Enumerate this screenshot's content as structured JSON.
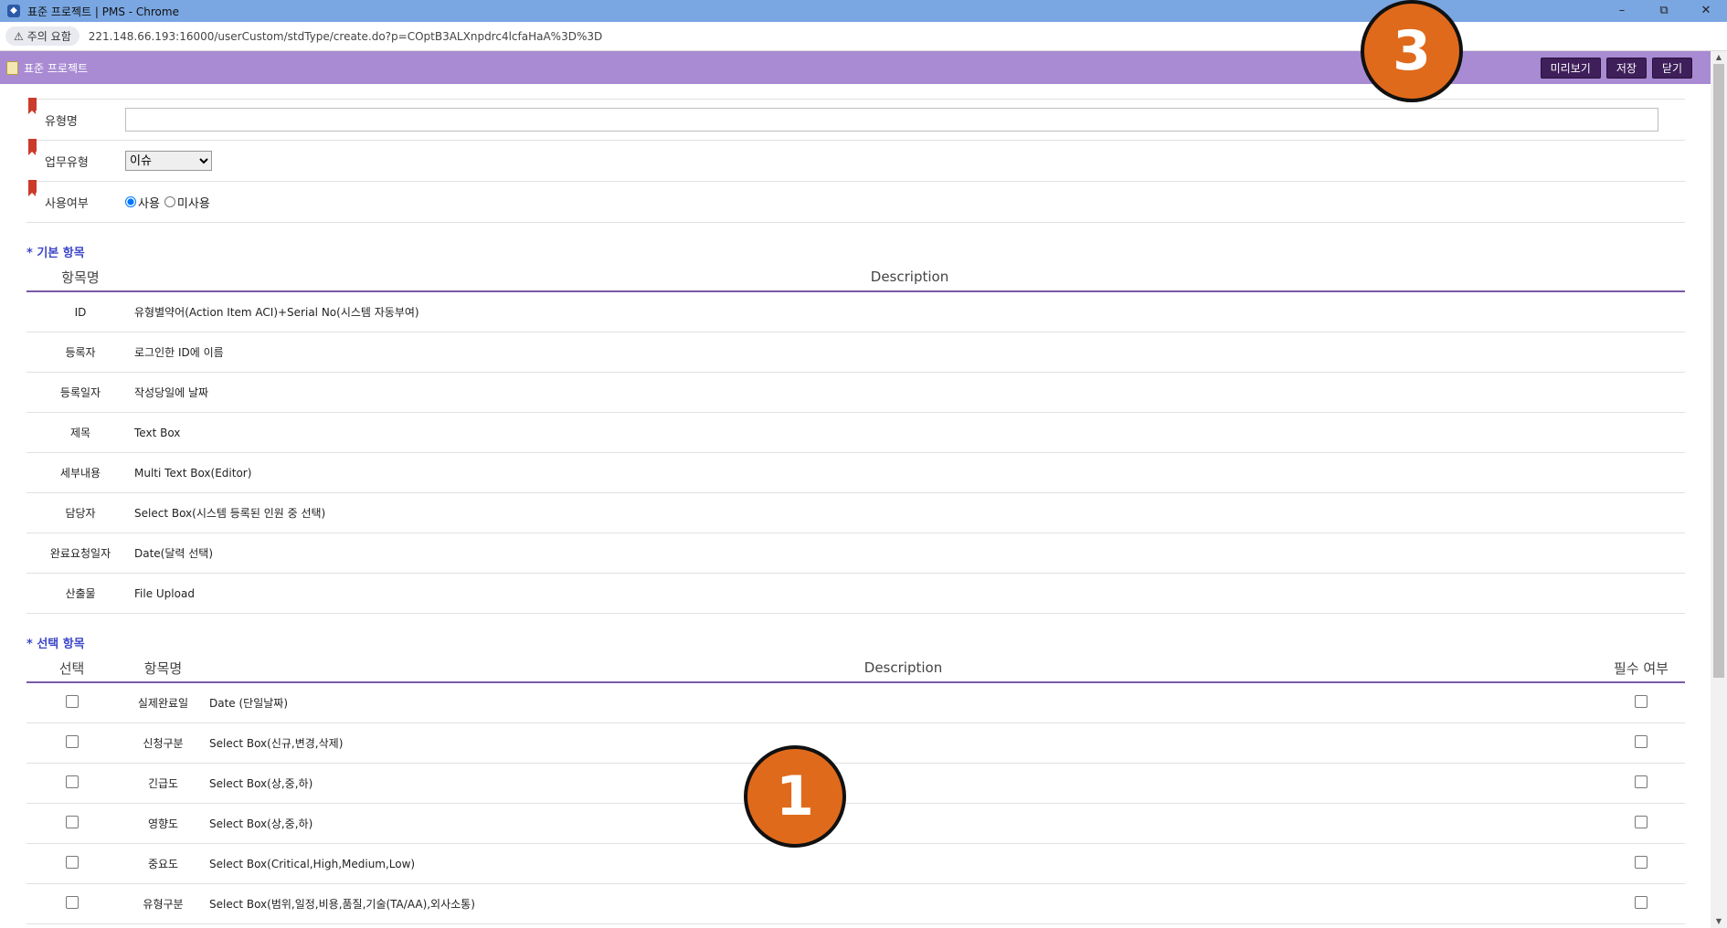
{
  "window": {
    "title": "표준 프로젝트 | PMS - Chrome",
    "minimize": "–",
    "restore": "⧉",
    "close": "✕"
  },
  "address": {
    "security_label": "주의 요함",
    "url": "221.148.66.193:16000/userCustom/stdType/create.do?p=COptB3ALXnpdrc4lcfaHaA%3D%3D"
  },
  "header": {
    "title": "표준 프로젝트",
    "buttons": {
      "preview": "미리보기",
      "save": "저장",
      "close": "닫기"
    }
  },
  "form": {
    "type_name_label": "유형명",
    "type_name_value": "",
    "work_type_label": "업무유형",
    "work_type_value": "이슈",
    "use_label": "사용여부",
    "use_option": "사용",
    "unuse_option": "미사용"
  },
  "basic": {
    "title": "* 기본 항목",
    "col_name": "항목명",
    "col_desc": "Description",
    "rows": [
      {
        "name": "ID",
        "desc": "유형별약어(Action Item ACI)+Serial No(시스템 자동부여)"
      },
      {
        "name": "등록자",
        "desc": "로그인한 ID에 이름"
      },
      {
        "name": "등록일자",
        "desc": "작성당일에 날짜"
      },
      {
        "name": "제목",
        "desc": "Text Box"
      },
      {
        "name": "세부내용",
        "desc": "Multi Text Box(Editor)"
      },
      {
        "name": "담당자",
        "desc": "Select Box(시스템 등록된 인원 중 선택)"
      },
      {
        "name": "완료요청일자",
        "desc": "Date(달력 선택)"
      },
      {
        "name": "산출물",
        "desc": "File Upload"
      }
    ]
  },
  "optional": {
    "title": "* 선택 항목",
    "col_select": "선택",
    "col_name": "항목명",
    "col_desc": "Description",
    "col_required": "필수 여부",
    "rows": [
      {
        "name": "실제완료일",
        "desc": "Date (단일날짜)"
      },
      {
        "name": "신청구분",
        "desc": "Select Box(신규,변경,삭제)"
      },
      {
        "name": "긴급도",
        "desc": "Select Box(상,중,하)"
      },
      {
        "name": "영향도",
        "desc": "Select Box(상,중,하)"
      },
      {
        "name": "중요도",
        "desc": "Select Box(Critical,High,Medium,Low)"
      },
      {
        "name": "유형구분",
        "desc": "Select Box(범위,일정,비용,품질,기술(TA/AA),외사소통)"
      }
    ]
  },
  "callouts": {
    "a": "3",
    "b": "1"
  },
  "colors": {
    "header": "#a98bd3",
    "button": "#3e1f5a",
    "callout": "#e06a1b"
  }
}
